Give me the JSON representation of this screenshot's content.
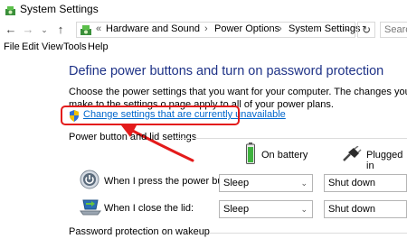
{
  "window": {
    "title": "System Settings"
  },
  "address_bar": {
    "breadcrumbs": [
      "Hardware and Sound",
      "Power Options",
      "System Settings"
    ],
    "search_placeholder": "Search"
  },
  "menu": {
    "items": [
      "File",
      "Edit",
      "View",
      "Tools",
      "Help"
    ]
  },
  "content": {
    "heading": "Define power buttons and turn on password protection",
    "description": "Choose the power settings that you want for your computer. The changes you make to the settings o page apply to all of your power plans.",
    "change_link": "Change settings that are currently unavailable",
    "power_group_label": "Power button and lid settings",
    "columns": {
      "battery": "On battery",
      "plugged": "Plugged in"
    },
    "rows": [
      {
        "label": "When I press the power button:",
        "battery": "Sleep",
        "plugged": "Shut down"
      },
      {
        "label": "When I close the lid:",
        "battery": "Sleep",
        "plugged": "Shut down"
      }
    ],
    "password_group_label": "Password protection on wakeup"
  },
  "colors": {
    "heading": "#1e3287",
    "link": "#0066cc",
    "highlight": "#e31b1b"
  },
  "icons": [
    "control-panel-icon",
    "back-arrow-icon",
    "forward-arrow-icon",
    "up-arrow-icon",
    "refresh-icon",
    "shield-icon",
    "battery-icon",
    "plug-icon",
    "power-button-icon",
    "laptop-lid-icon"
  ]
}
